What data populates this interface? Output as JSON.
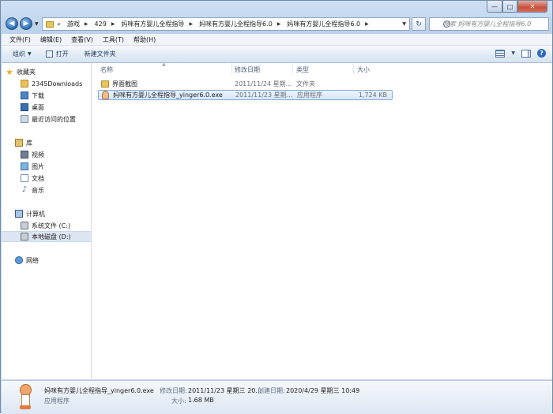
{
  "address": {
    "overflow": "«",
    "crumbs": [
      "游戏",
      "429",
      "妈咪有方婴儿全程指导",
      "妈咪有方婴儿全程指导6.0",
      "妈咪有方婴儿全程指导6.0"
    ]
  },
  "search": {
    "placeholder": "搜索 妈咪有方婴儿全程指导6.0"
  },
  "menu": [
    "文件(F)",
    "编辑(E)",
    "查看(V)",
    "工具(T)",
    "帮助(H)"
  ],
  "toolbar": {
    "organize": "组织",
    "open": "打开",
    "new_folder": "新建文件夹"
  },
  "nav": {
    "favorites": "收藏夹",
    "fav_items": [
      "2345Downloads",
      "下载",
      "桌面",
      "最近访问的位置"
    ],
    "libraries": "库",
    "lib_items": [
      "视频",
      "图片",
      "文档",
      "音乐"
    ],
    "computer": "计算机",
    "drives": [
      "系统文件 (C:)",
      "本地磁盘 (D:)"
    ],
    "network": "网络"
  },
  "columns": {
    "name": "名称",
    "modified": "修改日期",
    "type": "类型",
    "size": "大小"
  },
  "files": [
    {
      "name": "界面截图",
      "modified": "2011/11/24 星期...",
      "type": "文件夹",
      "size": ""
    },
    {
      "name": "妈咪有方婴儿全程指导_yinger6.0.exe",
      "modified": "2011/11/23 星期...",
      "type": "应用程序",
      "size": "1,724 KB"
    }
  ],
  "details": {
    "filename": "妈咪有方婴儿全程指导_yinger6.0.exe",
    "type": "应用程序",
    "modified_label": "修改日期:",
    "modified_value": "2011/11/23 星期三 20...",
    "created_label": "创建日期:",
    "created_value": "2020/4/29 星期三 10:49",
    "size_label": "大小:",
    "size_value": "1.68 MB"
  }
}
